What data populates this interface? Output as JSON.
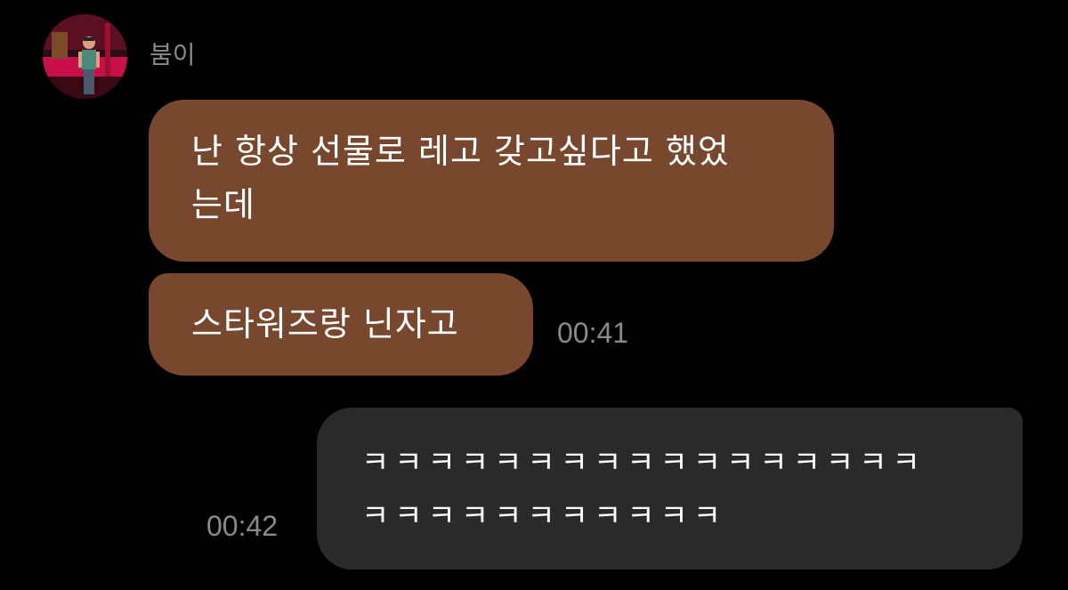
{
  "sender": {
    "name": "붐이"
  },
  "messages": [
    {
      "direction": "incoming",
      "lines": [
        "난 항상 선물로 레고 갖고싶다고 했었",
        "는데"
      ]
    },
    {
      "direction": "incoming",
      "lines": [
        "스타워즈랑 닌자고"
      ],
      "time": "00:41"
    },
    {
      "direction": "outgoing",
      "lines": [
        "ㅋㅋㅋㅋㅋㅋㅋㅋㅋㅋㅋㅋㅋㅋㅋㅋㅋ",
        "ㅋㅋㅋㅋㅋㅋㅋㅋㅋㅋㅋ"
      ],
      "time": "00:42"
    }
  ],
  "colors": {
    "background": "#000000",
    "incoming_bubble": "#77482e",
    "outgoing_bubble": "#2a2a2a",
    "meta_text": "#8a8a8a",
    "message_text": "#ffffff"
  }
}
